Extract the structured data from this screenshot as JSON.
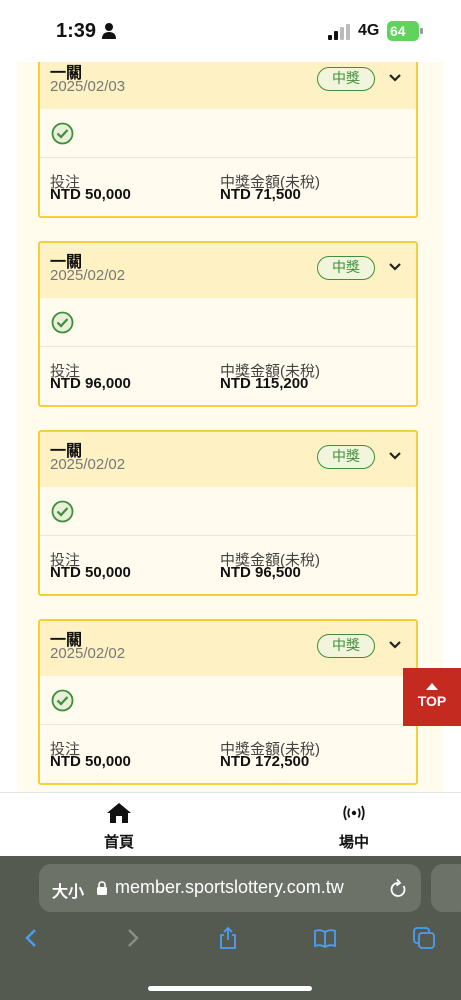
{
  "status_bar": {
    "time": "1:39",
    "network": "4G",
    "battery": "64"
  },
  "cards": [
    {
      "title": "一關",
      "date": "2025/02/03",
      "badge": "中獎",
      "bet_label": "投注",
      "bet_value": "NTD 50,000",
      "win_label": "中獎金額(未稅)",
      "win_value": "NTD 71,500"
    },
    {
      "title": "一關",
      "date": "2025/02/02",
      "badge": "中獎",
      "bet_label": "投注",
      "bet_value": "NTD 96,000",
      "win_label": "中獎金額(未稅)",
      "win_value": "NTD 115,200"
    },
    {
      "title": "一關",
      "date": "2025/02/02",
      "badge": "中獎",
      "bet_label": "投注",
      "bet_value": "NTD 50,000",
      "win_label": "中獎金額(未稅)",
      "win_value": "NTD 96,500"
    },
    {
      "title": "一關",
      "date": "2025/02/02",
      "badge": "中獎",
      "bet_label": "投注",
      "bet_value": "NTD 50,000",
      "win_label": "中獎金額(未稅)",
      "win_value": "NTD 172,500"
    }
  ],
  "top_button": {
    "label": "TOP"
  },
  "bottom_nav": [
    {
      "label": "首頁",
      "icon": "home-icon"
    },
    {
      "label": "場中",
      "icon": "live-broadcast-icon"
    }
  ],
  "browser": {
    "text_size_label": "大小",
    "url": "member.sportslottery.com.tw"
  },
  "colors": {
    "card_border": "#f5cf3a",
    "badge_green": "#3f8f3a",
    "top_button": "#c42a1f",
    "toolbar_blue": "#4a9ef5"
  }
}
